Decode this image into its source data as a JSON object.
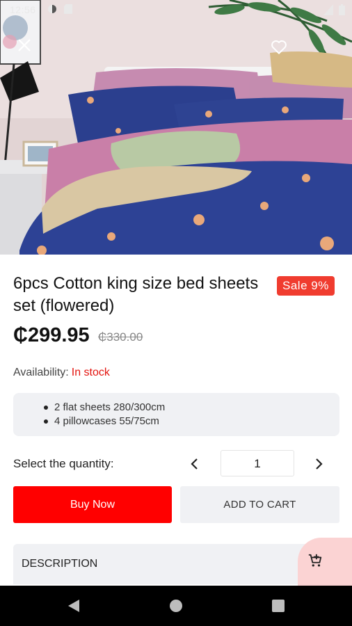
{
  "status_bar": {
    "time": "12:56"
  },
  "product": {
    "title": "6pcs Cotton king size bed sheets set (flowered)",
    "sale_badge": "Sale 9%",
    "price": "₵299.95",
    "old_price": "₵330.00",
    "availability_label": "Availability:",
    "availability_value": "In stock",
    "features": [
      "2 flat sheets 280/300cm",
      "4 pillowcases 55/75cm"
    ]
  },
  "quantity": {
    "label": "Select the quantity:",
    "value": "1"
  },
  "actions": {
    "buy_now": "Buy Now",
    "add_to_cart": "ADD TO CART"
  },
  "sections": {
    "description": "DESCRIPTION"
  },
  "colors": {
    "accent_red": "#ff0000",
    "sale_red": "#f03c2f",
    "stock_red": "#e3140f",
    "fab_pink": "#fbd3d3",
    "panel_grey": "#f0f1f4"
  },
  "icons": {
    "close": "close-icon",
    "favorite": "heart-outline-icon",
    "cart": "add-shopping-cart-icon",
    "prev": "chevron-left-icon",
    "next": "chevron-right-icon"
  }
}
